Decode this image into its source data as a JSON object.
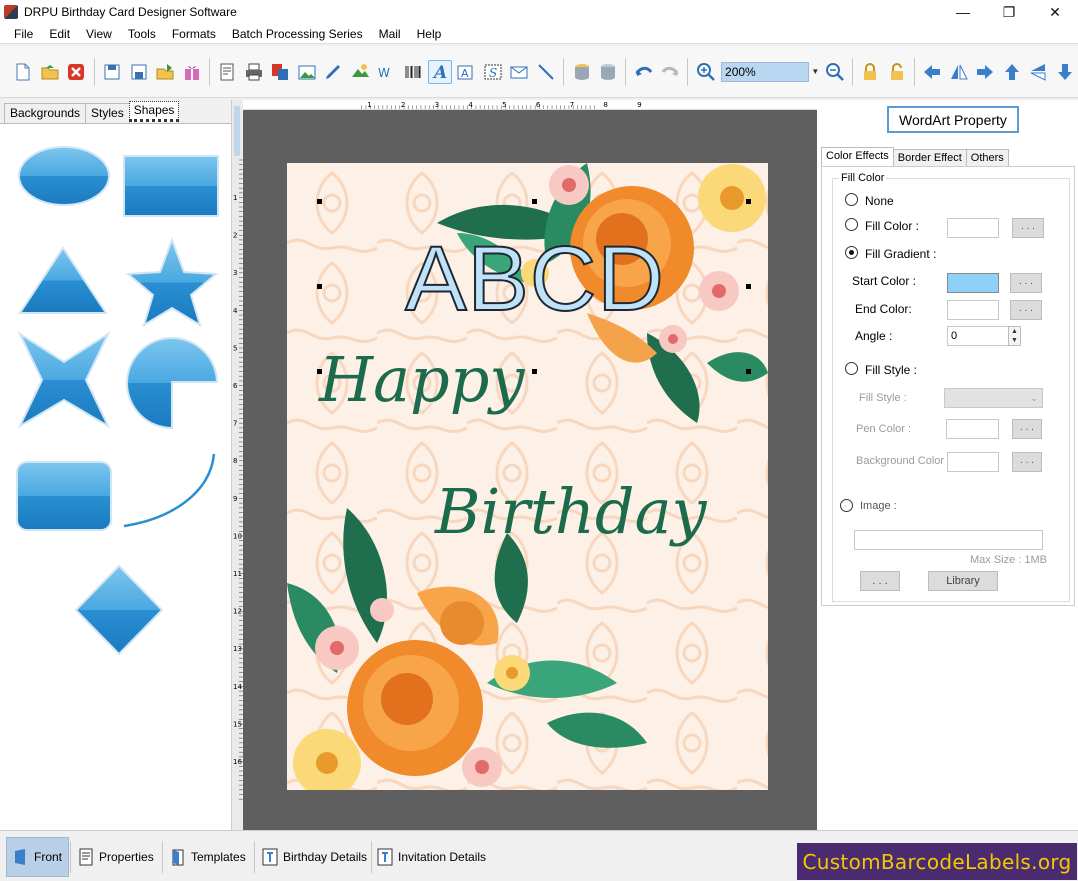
{
  "window": {
    "title": "DRPU Birthday Card Designer Software"
  },
  "menu": [
    "File",
    "Edit",
    "View",
    "Tools",
    "Formats",
    "Batch Processing Series",
    "Mail",
    "Help"
  ],
  "toolbar": {
    "zoom": "200%"
  },
  "left_tabs": [
    "Backgrounds",
    "Styles",
    "Shapes"
  ],
  "card": {
    "title": "ABCD",
    "line1": "Happy",
    "line2": "Birthday"
  },
  "ruler": {
    "h_ticks": [
      "1",
      "2",
      "3",
      "4",
      "5",
      "6",
      "7",
      "8",
      "9"
    ],
    "v_ticks": [
      "1",
      "2",
      "3",
      "4",
      "5",
      "6",
      "7",
      "8",
      "9",
      "10",
      "11",
      "12",
      "13",
      "14",
      "15",
      "16"
    ]
  },
  "wordart": {
    "button": "WordArt Property",
    "tabs": [
      "Color Effects",
      "Border Effect",
      "Others"
    ],
    "group": "Fill Color",
    "opt_none": "None",
    "opt_fill_color": "Fill Color :",
    "opt_fill_gradient": "Fill Gradient :",
    "start_color_label": "Start Color :",
    "start_color": "#8fd0f7",
    "end_color_label": "End Color:",
    "angle_label": "Angle :",
    "angle_value": "0",
    "opt_fill_style": "Fill Style :",
    "fill_style_label": "Fill Style :",
    "pen_color_label": "Pen Color :",
    "bg_color_label": "Background Color :",
    "opt_image": "Image :",
    "max_size": "Max Size : 1MB",
    "dots": ". . .",
    "library": "Library"
  },
  "bottom_tabs": [
    "Front",
    "Properties",
    "Templates",
    "Birthday Details",
    "Invitation Details"
  ],
  "brand": "CustomBarcodeLabels.org"
}
